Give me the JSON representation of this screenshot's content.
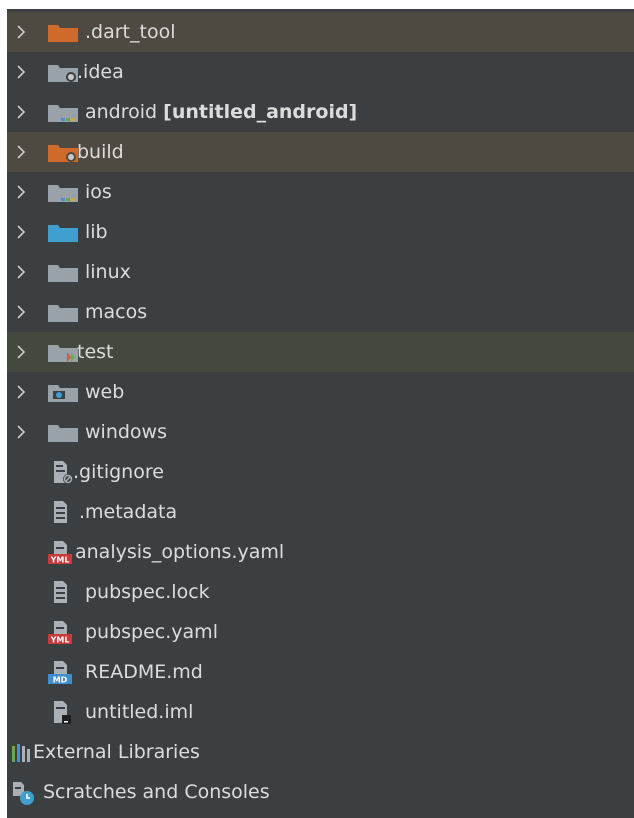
{
  "colors": {
    "panel_bg": "#3c3f41",
    "excluded_row_bg": "#4f4a41",
    "test_row_bg": "#44493f",
    "text": "#dcdcdc",
    "folder_gray": "#9aa2a9",
    "folder_orange": "#cf6a2a",
    "folder_blue": "#3f9fcf",
    "folder_green_test": "#6a9f5a"
  },
  "tree": {
    "items": [
      {
        "label": ".dart_tool",
        "icon": "excluded-folder-icon",
        "expandable": true
      },
      {
        "label": ".idea",
        "icon": "idea-folder-icon",
        "expandable": true
      },
      {
        "label": "android",
        "suffix": "[untitled_android]",
        "icon": "module-folder-icon",
        "expandable": true
      },
      {
        "label": "build",
        "icon": "build-folder-icon",
        "expandable": true
      },
      {
        "label": "ios",
        "icon": "module-folder-icon",
        "expandable": true
      },
      {
        "label": "lib",
        "icon": "source-folder-icon",
        "expandable": true
      },
      {
        "label": "linux",
        "icon": "folder-icon",
        "expandable": true
      },
      {
        "label": "macos",
        "icon": "folder-icon",
        "expandable": true
      },
      {
        "label": "test",
        "icon": "test-folder-icon",
        "expandable": true
      },
      {
        "label": "web",
        "icon": "web-folder-icon",
        "expandable": true
      },
      {
        "label": "windows",
        "icon": "folder-icon",
        "expandable": true
      },
      {
        "label": ".gitignore",
        "icon": "ignore-file-icon",
        "expandable": false
      },
      {
        "label": ".metadata",
        "icon": "text-file-icon",
        "expandable": false
      },
      {
        "label": "analysis_options.yaml",
        "icon": "yaml-file-icon",
        "expandable": false
      },
      {
        "label": "pubspec.lock",
        "icon": "text-file-icon",
        "expandable": false
      },
      {
        "label": "pubspec.yaml",
        "icon": "yaml-file-icon",
        "expandable": false
      },
      {
        "label": "README.md",
        "icon": "markdown-file-icon",
        "expandable": false
      },
      {
        "label": "untitled.iml",
        "icon": "iml-file-icon",
        "expandable": false
      },
      {
        "label": "External Libraries",
        "icon": "external-libraries-icon",
        "expandable": false
      },
      {
        "label": "Scratches and Consoles",
        "icon": "scratches-icon",
        "expandable": false
      }
    ]
  }
}
